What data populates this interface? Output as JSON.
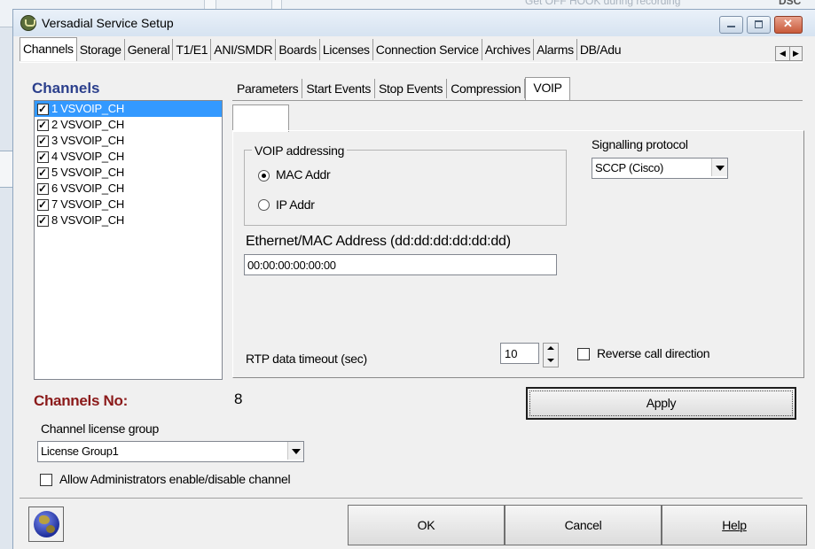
{
  "background": {
    "text1": "Get OFF HOOK during recording",
    "text2": "DSC"
  },
  "window": {
    "title": "Versadial Service Setup"
  },
  "top_tabs": [
    "Channels",
    "Storage",
    "General",
    "T1/E1",
    "ANI/SMDR",
    "Boards",
    "Licenses",
    "Connection Service",
    "Archives",
    "Alarms",
    "DB/Adu"
  ],
  "channels_section": {
    "heading": "Channels",
    "items": [
      {
        "label": "1 VSVOIP_CH",
        "checked": true,
        "selected": true
      },
      {
        "label": "2 VSVOIP_CH",
        "checked": true,
        "selected": false
      },
      {
        "label": "3 VSVOIP_CH",
        "checked": true,
        "selected": false
      },
      {
        "label": "4 VSVOIP_CH",
        "checked": true,
        "selected": false
      },
      {
        "label": "5 VSVOIP_CH",
        "checked": true,
        "selected": false
      },
      {
        "label": "6 VSVOIP_CH",
        "checked": true,
        "selected": false
      },
      {
        "label": "7 VSVOIP_CH",
        "checked": true,
        "selected": false
      },
      {
        "label": "8 VSVOIP_CH",
        "checked": true,
        "selected": false
      }
    ],
    "count_label": "Channels No:",
    "count_value": "8"
  },
  "inner_tabs": [
    "Parameters",
    "Start Events",
    "Stop Events",
    "Compression",
    "VOIP"
  ],
  "voip": {
    "addressing_label": "VOIP addressing",
    "mac_option": "MAC Addr",
    "ip_option": "IP Addr",
    "signalling_label": "Signalling protocol",
    "signalling_value": "SCCP (Cisco)",
    "ethernet_label": "Ethernet/MAC Address (dd:dd:dd:dd:dd:dd)",
    "ethernet_value": "00:00:00:00:00:00",
    "rtp_label": "RTP data timeout (sec)",
    "rtp_value": "10",
    "reverse_label": "Reverse call direction"
  },
  "apply_label": "Apply",
  "license": {
    "label": "Channel license group",
    "value": "License Group1",
    "admin_label": "Allow Administrators enable/disable channel"
  },
  "buttons": {
    "ok": "OK",
    "cancel": "Cancel",
    "help": "Help"
  },
  "colors": {
    "heading_blue": "#2b3f8c",
    "count_red": "#8b1a1a",
    "selection": "#3399ff"
  }
}
